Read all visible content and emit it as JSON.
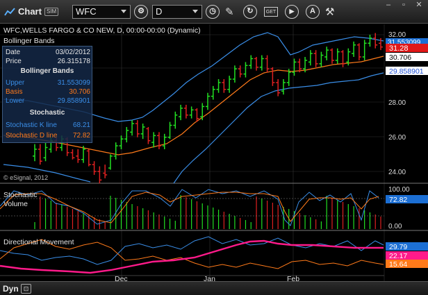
{
  "toolbar": {
    "title": "Chart",
    "badge": "SIM",
    "symbol_value": "WFC",
    "interval_value": "D",
    "icons": [
      "chart-icon",
      "settings-gear-icon",
      "clock-icon",
      "pencil-icon",
      "redraw-icon",
      "get-data-icon",
      "play-icon",
      "alert-icon",
      "tools-icon",
      "minimize-icon",
      "restore-icon",
      "close-icon"
    ]
  },
  "chart": {
    "header": "WFC,WELLS FARGO & CO NEW, D, 00:00-00:00 (Dynamic)",
    "study_label": "Bollinger Bands",
    "copyright": "© eSignal, 2012"
  },
  "data_window": {
    "date_label": "Date",
    "date_value": "03/02/2012",
    "price_label": "Price",
    "price_value": "26.315178",
    "bb_title": "Bollinger Bands",
    "upper_label": "Upper",
    "upper_value": "31.553099",
    "basis_label": "Basis",
    "basis_value": "30.706",
    "lower_label": "Lower",
    "lower_value": "29.858901",
    "stoch_title": "Stochastic",
    "k_label": "Stochastic K line",
    "k_value": "68.21",
    "d_label": "Stochastic D line",
    "d_value": "72.82"
  },
  "price_axis": {
    "ticks": [
      "32.00",
      "30.00",
      "28.00",
      "26.00",
      "24.00"
    ],
    "markers": {
      "upper": "31.553099",
      "last": "31.28",
      "basis": "30.706",
      "lower": "29.858901"
    }
  },
  "stoch_pane": {
    "title": "Stochastic",
    "subtitle": "Volume",
    "ticks": [
      "100.00",
      "0.00"
    ],
    "d_marker": "72.82"
  },
  "dm_pane": {
    "title": "Directional Movement",
    "markers": [
      "29.79",
      "22.17",
      "15.64"
    ]
  },
  "time_axis": [
    "Dec",
    "Jan",
    "Feb"
  ],
  "bottom": {
    "label": "Dyn"
  },
  "colors": {
    "upper": "#3a8ee8",
    "basis": "#ff7a1a",
    "lower": "#3a8ee8",
    "last": "#ff2020",
    "up": "#22e022",
    "down": "#e02020",
    "dmi_plus": "#3a8ee8",
    "dmi_minus": "#ff7a1a",
    "adx": "#ff1a8a"
  },
  "chart_data": {
    "type": "ohlc",
    "ylim": [
      23.2,
      32.6
    ],
    "candles": [
      {
        "c": "up",
        "o": 24.9,
        "h": 25.6,
        "l": 24.6,
        "cl": 25.3
      },
      {
        "c": "down",
        "o": 25.3,
        "h": 25.6,
        "l": 24.4,
        "cl": 24.6
      },
      {
        "c": "up",
        "o": 24.8,
        "h": 25.7,
        "l": 24.6,
        "cl": 25.4
      },
      {
        "c": "up",
        "o": 25.3,
        "h": 26.0,
        "l": 25.1,
        "cl": 25.8
      },
      {
        "c": "down",
        "o": 25.8,
        "h": 26.0,
        "l": 25.2,
        "cl": 25.4
      },
      {
        "c": "up",
        "o": 25.4,
        "h": 26.1,
        "l": 25.2,
        "cl": 25.9
      },
      {
        "c": "down",
        "o": 25.9,
        "h": 26.0,
        "l": 24.9,
        "cl": 25.1
      },
      {
        "c": "down",
        "o": 25.1,
        "h": 25.3,
        "l": 24.7,
        "cl": 24.8
      },
      {
        "c": "down",
        "o": 24.9,
        "h": 25.3,
        "l": 24.5,
        "cl": 24.7
      },
      {
        "c": "up",
        "o": 24.7,
        "h": 25.5,
        "l": 24.5,
        "cl": 25.3
      },
      {
        "c": "down",
        "o": 25.2,
        "h": 25.3,
        "l": 24.3,
        "cl": 24.4
      },
      {
        "c": "down",
        "o": 24.4,
        "h": 24.6,
        "l": 23.8,
        "cl": 24.0
      },
      {
        "c": "down",
        "o": 24.0,
        "h": 24.3,
        "l": 23.3,
        "cl": 23.5
      },
      {
        "c": "down",
        "o": 23.9,
        "h": 24.4,
        "l": 23.6,
        "cl": 23.8
      },
      {
        "c": "up",
        "o": 24.2,
        "h": 25.0,
        "l": 24.1,
        "cl": 24.9
      },
      {
        "c": "up",
        "o": 24.9,
        "h": 25.7,
        "l": 24.7,
        "cl": 25.5
      },
      {
        "c": "up",
        "o": 25.5,
        "h": 26.1,
        "l": 25.3,
        "cl": 25.9
      },
      {
        "c": "up",
        "o": 25.9,
        "h": 26.6,
        "l": 25.7,
        "cl": 26.4
      },
      {
        "c": "up",
        "o": 26.3,
        "h": 27.0,
        "l": 26.1,
        "cl": 26.8
      },
      {
        "c": "down",
        "o": 26.8,
        "h": 27.0,
        "l": 26.0,
        "cl": 26.2
      },
      {
        "c": "up",
        "o": 26.2,
        "h": 26.8,
        "l": 25.9,
        "cl": 26.6
      },
      {
        "c": "down",
        "o": 26.5,
        "h": 26.6,
        "l": 25.6,
        "cl": 25.8
      },
      {
        "c": "up",
        "o": 25.7,
        "h": 26.3,
        "l": 25.4,
        "cl": 26.1
      },
      {
        "c": "down",
        "o": 26.1,
        "h": 26.3,
        "l": 25.3,
        "cl": 25.5
      },
      {
        "c": "up",
        "o": 25.5,
        "h": 26.2,
        "l": 25.3,
        "cl": 26.0
      },
      {
        "c": "up",
        "o": 26.0,
        "h": 26.9,
        "l": 25.9,
        "cl": 26.7
      },
      {
        "c": "up",
        "o": 26.7,
        "h": 27.5,
        "l": 26.5,
        "cl": 27.3
      },
      {
        "c": "up",
        "o": 27.2,
        "h": 27.9,
        "l": 27.0,
        "cl": 27.7
      },
      {
        "c": "down",
        "o": 27.7,
        "h": 27.9,
        "l": 27.1,
        "cl": 27.3
      },
      {
        "c": "up",
        "o": 27.3,
        "h": 27.8,
        "l": 27.1,
        "cl": 27.6
      },
      {
        "c": "down",
        "o": 27.6,
        "h": 27.7,
        "l": 26.9,
        "cl": 27.1
      },
      {
        "c": "up",
        "o": 27.2,
        "h": 28.0,
        "l": 27.0,
        "cl": 27.8
      },
      {
        "c": "up",
        "o": 27.8,
        "h": 28.6,
        "l": 27.6,
        "cl": 28.4
      },
      {
        "c": "up",
        "o": 28.4,
        "h": 29.0,
        "l": 28.2,
        "cl": 28.8
      },
      {
        "c": "up",
        "o": 28.8,
        "h": 29.4,
        "l": 28.6,
        "cl": 29.2
      },
      {
        "c": "down",
        "o": 29.2,
        "h": 29.4,
        "l": 28.6,
        "cl": 28.8
      },
      {
        "c": "up",
        "o": 28.8,
        "h": 29.6,
        "l": 28.6,
        "cl": 29.4
      },
      {
        "c": "up",
        "o": 29.4,
        "h": 30.2,
        "l": 29.2,
        "cl": 30.0
      },
      {
        "c": "down",
        "o": 30.0,
        "h": 30.2,
        "l": 29.5,
        "cl": 29.7
      },
      {
        "c": "up",
        "o": 29.7,
        "h": 30.4,
        "l": 29.5,
        "cl": 30.2
      },
      {
        "c": "up",
        "o": 30.2,
        "h": 30.8,
        "l": 30.0,
        "cl": 30.6
      },
      {
        "c": "down",
        "o": 30.6,
        "h": 30.7,
        "l": 29.9,
        "cl": 30.1
      },
      {
        "c": "up",
        "o": 30.1,
        "h": 30.8,
        "l": 29.9,
        "cl": 30.6
      },
      {
        "c": "down",
        "o": 30.6,
        "h": 30.8,
        "l": 29.8,
        "cl": 30.0
      },
      {
        "c": "down",
        "o": 30.0,
        "h": 30.1,
        "l": 29.0,
        "cl": 29.2
      },
      {
        "c": "down",
        "o": 29.2,
        "h": 29.4,
        "l": 28.4,
        "cl": 28.6
      },
      {
        "c": "up",
        "o": 28.7,
        "h": 29.4,
        "l": 28.5,
        "cl": 29.2
      },
      {
        "c": "up",
        "o": 29.2,
        "h": 30.0,
        "l": 29.0,
        "cl": 29.8
      },
      {
        "c": "up",
        "o": 29.8,
        "h": 30.6,
        "l": 29.6,
        "cl": 30.4
      },
      {
        "c": "down",
        "o": 30.4,
        "h": 30.6,
        "l": 29.8,
        "cl": 30.0
      },
      {
        "c": "up",
        "o": 30.0,
        "h": 30.7,
        "l": 29.8,
        "cl": 30.5
      },
      {
        "c": "up",
        "o": 30.4,
        "h": 31.1,
        "l": 30.2,
        "cl": 30.9
      },
      {
        "c": "down",
        "o": 30.9,
        "h": 31.1,
        "l": 30.1,
        "cl": 30.3
      },
      {
        "c": "up",
        "o": 30.3,
        "h": 31.0,
        "l": 30.1,
        "cl": 30.8
      },
      {
        "c": "up",
        "o": 30.7,
        "h": 31.3,
        "l": 30.5,
        "cl": 31.1
      },
      {
        "c": "down",
        "o": 31.1,
        "h": 31.2,
        "l": 30.3,
        "cl": 30.5
      },
      {
        "c": "up",
        "o": 30.5,
        "h": 31.2,
        "l": 30.3,
        "cl": 31.0
      },
      {
        "c": "down",
        "o": 31.0,
        "h": 31.1,
        "l": 30.1,
        "cl": 30.3
      },
      {
        "c": "up",
        "o": 30.4,
        "h": 31.2,
        "l": 30.2,
        "cl": 31.0
      },
      {
        "c": "up",
        "o": 30.9,
        "h": 31.6,
        "l": 30.7,
        "cl": 31.4
      },
      {
        "c": "down",
        "o": 31.4,
        "h": 31.5,
        "l": 30.5,
        "cl": 30.7
      },
      {
        "c": "up",
        "o": 30.7,
        "h": 31.7,
        "l": 30.5,
        "cl": 31.5
      },
      {
        "c": "up",
        "o": 31.5,
        "h": 32.0,
        "l": 31.3,
        "cl": 31.8
      },
      {
        "c": "down",
        "o": 31.8,
        "h": 32.1,
        "l": 31.2,
        "cl": 31.4
      },
      {
        "c": "down",
        "o": 31.5,
        "h": 31.8,
        "l": 31.1,
        "cl": 31.28
      }
    ]
  }
}
